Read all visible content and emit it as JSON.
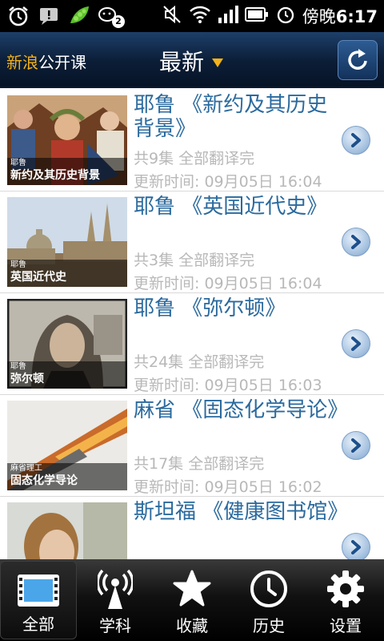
{
  "statusbar": {
    "time_prefix": "傍晚",
    "time": "6:17",
    "wechat_badge": "2"
  },
  "header": {
    "brand_accent": "新浪",
    "brand_rest": "公开课",
    "title": "最新",
    "refresh_icon": "refresh-icon"
  },
  "courses": [
    {
      "title": "耶鲁 《新约及其历史背景》",
      "episodes": "共9集 全部翻译完",
      "updated": "更新时间: 09月05日 16:04",
      "thumb_school": "耶鲁",
      "thumb_subtitle": "新约及其历史背景"
    },
    {
      "title": "耶鲁 《英国近代史》",
      "episodes": "共3集 全部翻译完",
      "updated": "更新时间: 09月05日 16:04",
      "thumb_school": "耶鲁",
      "thumb_subtitle": "英国近代史"
    },
    {
      "title": "耶鲁 《弥尔顿》",
      "episodes": "共24集 全部翻译完",
      "updated": "更新时间: 09月05日 16:03",
      "thumb_school": "耶鲁",
      "thumb_subtitle": "弥尔顿"
    },
    {
      "title": "麻省 《固态化学导论》",
      "episodes": "共17集 全部翻译完",
      "updated": "更新时间: 09月05日 16:02",
      "thumb_school": "麻省理工",
      "thumb_subtitle": "固态化学导论"
    },
    {
      "title": "斯坦福 《健康图书馆》",
      "episodes": "",
      "updated": "",
      "thumb_school": "",
      "thumb_subtitle": ""
    }
  ],
  "tabs": [
    {
      "label": "全部",
      "icon": "film-icon",
      "active": true
    },
    {
      "label": "学科",
      "icon": "antenna-icon",
      "active": false
    },
    {
      "label": "收藏",
      "icon": "star-icon",
      "active": false
    },
    {
      "label": "历史",
      "icon": "clock-icon",
      "active": false
    },
    {
      "label": "设置",
      "icon": "gear-icon",
      "active": false
    }
  ],
  "colors": {
    "brand_accent": "#f3b318",
    "course_title": "#2a6a9e",
    "meta_text": "#b8b8b8",
    "header_bg": "#0b1d36"
  }
}
